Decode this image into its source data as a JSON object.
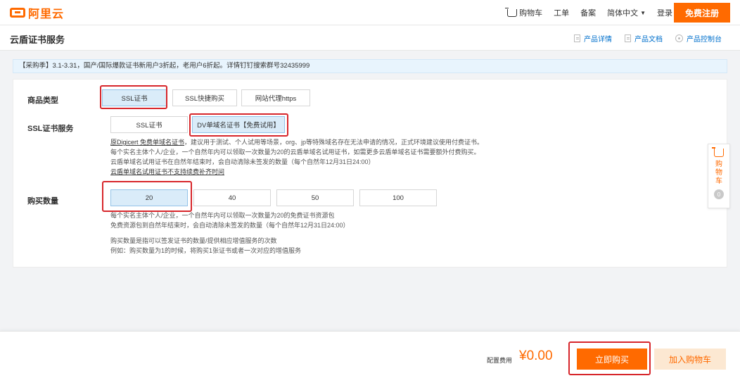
{
  "header": {
    "logo_text": "阿里云",
    "nav": [
      {
        "label": "购物车",
        "icon": "cart-icon"
      },
      {
        "label": "工单"
      },
      {
        "label": "备案"
      },
      {
        "label": "简体中文",
        "has_dropdown": true
      },
      {
        "label": "登录"
      }
    ],
    "register_label": "免费注册"
  },
  "titlebar": {
    "title": "云盾证书服务",
    "links": [
      {
        "label": "产品详情",
        "icon": "doc-icon"
      },
      {
        "label": "产品文档",
        "icon": "doc-icon"
      },
      {
        "label": "产品控制台",
        "icon": "gear-icon"
      }
    ]
  },
  "notice": "【采购季】3.1-3.31，国产/国际爆款证书新用户3折起，老用户6折起。详情钉钉搜索群号32435999",
  "form": {
    "product_type": {
      "label": "商品类型",
      "options": [
        "SSL证书",
        "SSL快捷购买",
        "网站代理https"
      ],
      "selected": "SSL证书"
    },
    "ssl_service": {
      "label": "SSL证书服务",
      "options": [
        "SSL证书",
        "DV单域名证书【免费试用】"
      ],
      "selected": "DV单域名证书【免费试用】",
      "desc": {
        "line1_link": "原Digicert 免费单域名证书",
        "line1_rest": "，建议用于测试、个人试用等场景，org、jp等特殊域名存在无法申请的情况，正式环境建议使用付费证书。",
        "line2": "每个实名主体个人/企业，一个自然年内可以领取一次数量为20的云盾单域名试用证书，如需更多云盾单域名证书需要额外付费购买。",
        "line3": "云盾单域名试用证书在自然年结束时，会自动清除未签发的数量（每个自然年12月31日24:00）",
        "line4": "云盾单域名试用证书不支持续费补齐时间"
      }
    },
    "quantity": {
      "label": "购买数量",
      "options": [
        "20",
        "40",
        "50",
        "100"
      ],
      "selected": "20",
      "desc_lines": [
        "每个实名主体个人/企业，一个自然年内可以领取一次数量为20的免费证书资源包",
        "免费资源包到自然年结束时，会自动清除未签发的数量（每个自然年12月31日24:00）",
        "购买数量是指可以签发证书的数量/提供相应增值服务的次数",
        "例如：购买数量为1的时候，将购买1张证书或者一次对应的增值服务"
      ]
    }
  },
  "float_cart": {
    "label": "购物车",
    "count": "0"
  },
  "footer": {
    "cost_label": "配置费用",
    "cost_value": "¥0.00",
    "buy_label": "立即购买",
    "add_cart_label": "加入购物车"
  },
  "colors": {
    "accent": "#ff6a00",
    "selected_bg": "#daecf9",
    "highlight": "#d7262b",
    "link": "#0070cc"
  }
}
